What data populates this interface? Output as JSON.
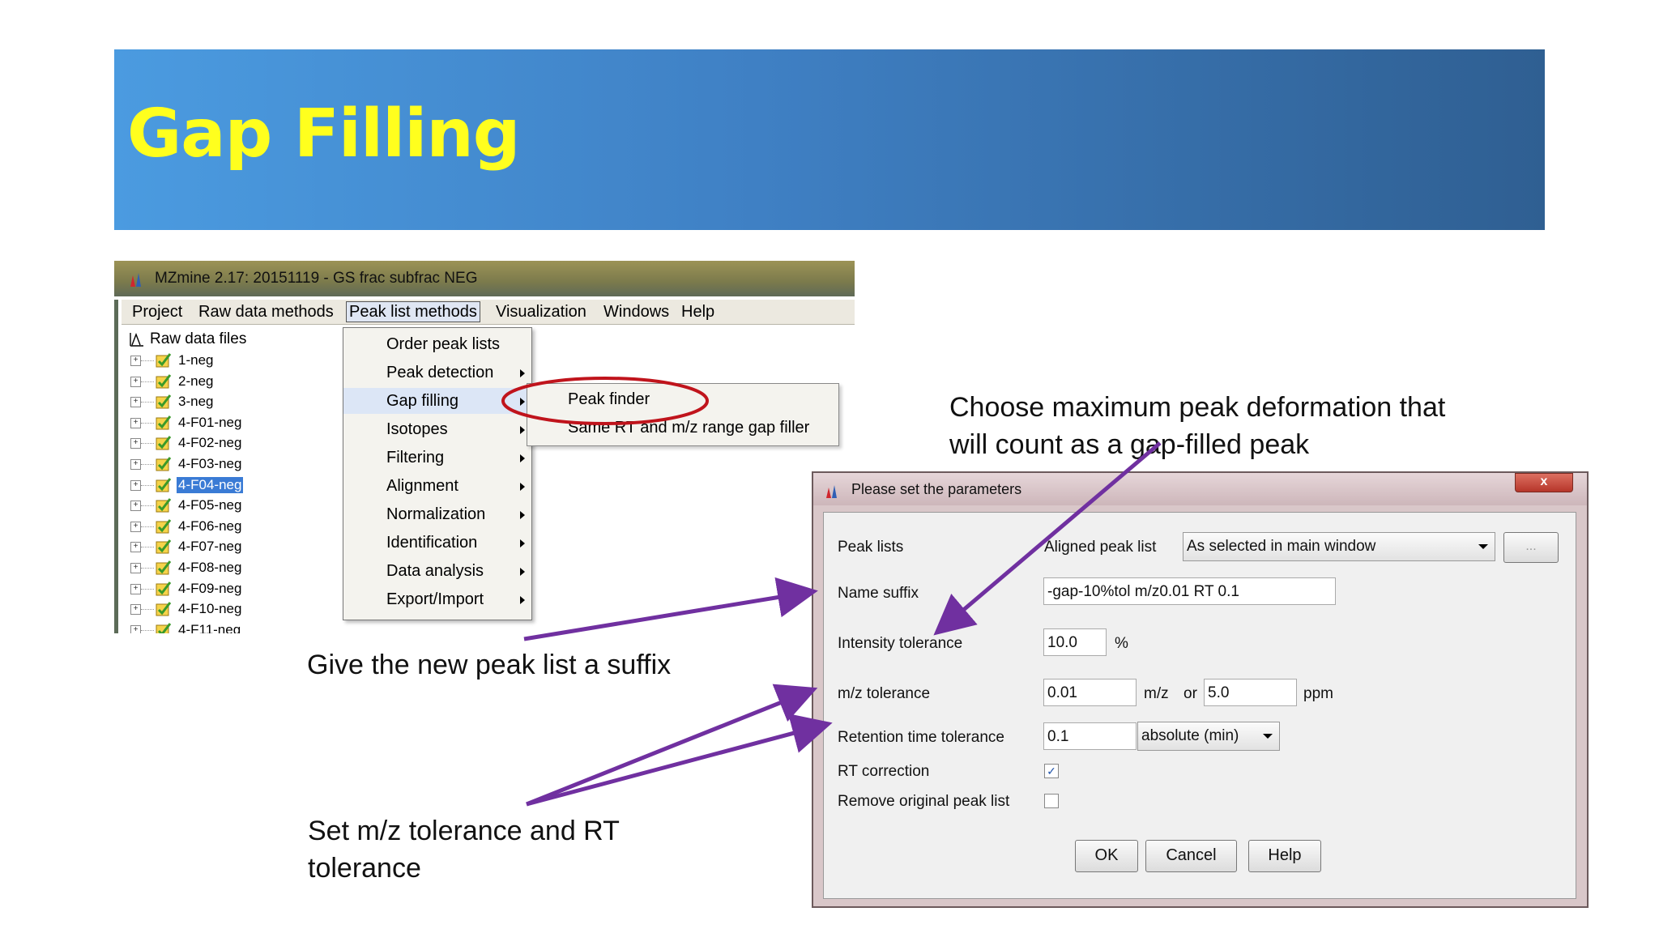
{
  "slide": {
    "title": "Gap Filling"
  },
  "mzmine": {
    "window_title": "MZmine 2.17: 20151119 - GS frac subfrac NEG",
    "menu": [
      "Project",
      "Raw data methods",
      "Peak list methods",
      "Visualization",
      "Windows",
      "Help"
    ],
    "tree_root": "Raw data files",
    "tree_items": [
      "1-neg",
      "2-neg",
      "3-neg",
      "4-F01-neg",
      "4-F02-neg",
      "4-F03-neg",
      "4-F04-neg",
      "4-F05-neg",
      "4-F06-neg",
      "4-F07-neg",
      "4-F08-neg",
      "4-F09-neg",
      "4-F10-neg",
      "4-F11-neg"
    ],
    "selected_item": "4-F04-neg",
    "dropdown": [
      "Order peak lists",
      "Peak detection",
      "Gap filling",
      "Isotopes",
      "Filtering",
      "Alignment",
      "Normalization",
      "Identification",
      "Data analysis",
      "Export/Import"
    ],
    "submenu": [
      "Peak finder",
      "Same RT and m/z range gap filler"
    ]
  },
  "dialog": {
    "title": "Please set the parameters",
    "close_glyph": "x",
    "peak_lists_label": "Peak lists",
    "peak_lists_value": "Aligned peak list",
    "peak_lists_select": "As selected in main window",
    "browse_label": "...",
    "name_suffix_label": "Name suffix",
    "name_suffix_value": "-gap-10%tol m/z0.01 RT 0.1",
    "intensity_label": "Intensity tolerance",
    "intensity_value": "10.0",
    "intensity_unit": "%",
    "mz_label": "m/z tolerance",
    "mz_value": "0.01",
    "mz_unit": "m/z",
    "or_text": "or",
    "ppm_value": "5.0",
    "ppm_unit": "ppm",
    "rt_label": "Retention time tolerance",
    "rt_value": "0.1",
    "rt_select": "absolute (min)",
    "rt_correction_label": "RT correction",
    "rt_correction_checked": true,
    "remove_label": "Remove original peak list",
    "remove_checked": false,
    "ok": "OK",
    "cancel": "Cancel",
    "help": "Help"
  },
  "annotations": {
    "deformation": [
      "Choose maximum peak deformation that",
      "will count as a gap-filled peak"
    ],
    "suffix": "Give the new peak list a suffix",
    "tolerance": [
      "Set m/z tolerance and RT",
      "tolerance"
    ]
  },
  "colors": {
    "title_yellow": "#ffff1e",
    "arrow_purple": "#7030a0",
    "ellipse_red": "#c0141c"
  }
}
